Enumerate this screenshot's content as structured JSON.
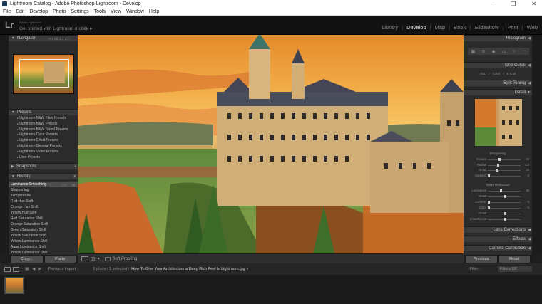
{
  "window": {
    "title": "Lightroom Catalog - Adobe Photoshop Lightroom - Develop",
    "controls": [
      "–",
      "❐",
      "✕"
    ]
  },
  "menu": [
    "File",
    "Edit",
    "Develop",
    "Photo",
    "Settings",
    "Tools",
    "View",
    "Window",
    "Help"
  ],
  "identity": {
    "logo": "Lr",
    "small": "Adobe Lightroom",
    "mobile": "Get started with Lightroom mobile ▸"
  },
  "modules": [
    "Library",
    "Develop",
    "Map",
    "Book",
    "Slideshow",
    "Print",
    "Web"
  ],
  "active_module": "Develop",
  "left": {
    "navigator": {
      "title": "Navigator",
      "zoom": "FIT  Fill  1:1  3:1"
    },
    "presets": {
      "title": "Presets",
      "items": [
        "Lightroom B&W Filter Presets",
        "Lightroom B&W Presets",
        "Lightroom B&W Toned Presets",
        "Lightroom Color Presets",
        "Lightroom Effect Presets",
        "Lightroom General Presets",
        "Lightroom Video Presets",
        "User Presets"
      ]
    },
    "snapshots": {
      "title": "Snapshots"
    },
    "history": {
      "title": "History",
      "close": "✕",
      "items": [
        {
          "name": "Luminance Smoothing",
          "v1": "+38",
          "v2": "38"
        },
        {
          "name": "Sharpening",
          "v1": "",
          "v2": ""
        },
        {
          "name": "Temperature",
          "v1": "",
          "v2": ""
        },
        {
          "name": "Red Hue Shift",
          "v1": "",
          "v2": ""
        },
        {
          "name": "Orange Hue Shift",
          "v1": "",
          "v2": ""
        },
        {
          "name": "Yellow Hue Shift",
          "v1": "",
          "v2": ""
        },
        {
          "name": "Red Saturation Shift",
          "v1": "",
          "v2": ""
        },
        {
          "name": "Orange Saturation Shift",
          "v1": "",
          "v2": ""
        },
        {
          "name": "Green Saturation Shift",
          "v1": "",
          "v2": ""
        },
        {
          "name": "Yellow Saturation Shift",
          "v1": "",
          "v2": ""
        },
        {
          "name": "Yellow Luminance Shift",
          "v1": "",
          "v2": ""
        },
        {
          "name": "Aqua Luminance Shift",
          "v1": "",
          "v2": ""
        },
        {
          "name": "Yellow Luminance Shift",
          "v1": "",
          "v2": ""
        }
      ]
    },
    "copy": "Copy...",
    "paste": "Paste"
  },
  "right": {
    "histogram": "Histogram",
    "tone_curve": "Tone Curve",
    "hsl_row": [
      "HSL",
      "/",
      "Color",
      "/",
      "B & W"
    ],
    "split_toning": "Split Toning",
    "detail": "Detail",
    "sharpening": {
      "title": "Sharpening",
      "rows": [
        {
          "label": "Amount",
          "value": "40",
          "pos": 0.32
        },
        {
          "label": "Radius",
          "value": "1.0",
          "pos": 0.28
        },
        {
          "label": "Detail",
          "value": "25",
          "pos": 0.25
        },
        {
          "label": "Masking",
          "value": "0",
          "pos": 0.0
        }
      ]
    },
    "noise": {
      "title": "Noise Reduction",
      "rows": [
        {
          "label": "Luminance",
          "value": "38",
          "pos": 0.38
        },
        {
          "label": "Detail",
          "value": "",
          "pos": 0.5
        },
        {
          "label": "Contrast",
          "value": "0",
          "pos": 0.0
        },
        {
          "label": "Color",
          "value": "0",
          "pos": 0.0
        },
        {
          "label": "Detail",
          "value": "",
          "pos": 0.5
        },
        {
          "label": "Smoothness",
          "value": "",
          "pos": 0.5
        }
      ]
    },
    "lens": "Lens Corrections",
    "effects": "Effects",
    "camera": "Camera Calibration",
    "previous": "Previous",
    "reset": "Reset"
  },
  "toolbar": {
    "soft_proofing": "Soft Proofing"
  },
  "filmstrip": {
    "source": "Previous Import",
    "info": "1 photo / 1 selected /",
    "filename": "How To Give Your Architecture a Deep Rich Feel In Lightroom.jpg",
    "filter_label": "Filter :",
    "filter_value": "Filters Off"
  }
}
